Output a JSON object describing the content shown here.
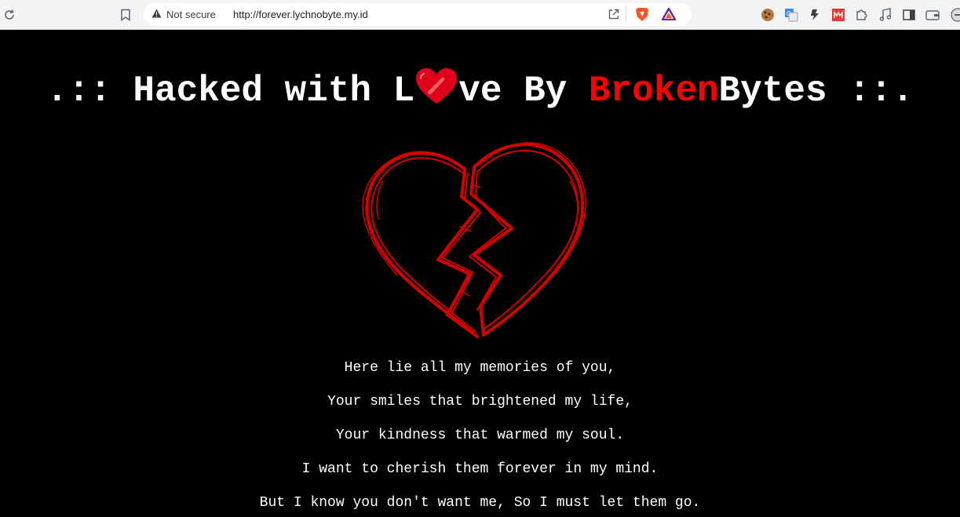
{
  "browser": {
    "security_label": "Not secure",
    "url": "http://forever.lychnobyte.my.id",
    "icons": [
      "reload-icon",
      "bookmark-icon",
      "warning-icon",
      "share-icon",
      "brave-shields-icon",
      "brave-rewards-icon",
      "cookie-extension-icon",
      "translate-extension-icon",
      "extension-icon",
      "red-extension-icon",
      "puzzle-extensions-icon",
      "music-icon",
      "sidebar-icon",
      "wallet-icon",
      "profile-icon"
    ]
  },
  "page": {
    "title": {
      "prefix": ".:: Hacked with L",
      "after_heart": "ve By ",
      "highlight": "Broken",
      "name_rest": "Bytes",
      "suffix": " ::."
    },
    "poem": [
      "Here lie all my memories of you,",
      "Your smiles that brightened my life,",
      "Your kindness that warmed my soul.",
      "I want to cherish them forever in my mind.",
      "But I know you don't want me, So I must let them go."
    ]
  },
  "colors": {
    "background": "#000000",
    "text": "#ffffff",
    "accent": "#ff0000",
    "heart": "#d40000"
  }
}
